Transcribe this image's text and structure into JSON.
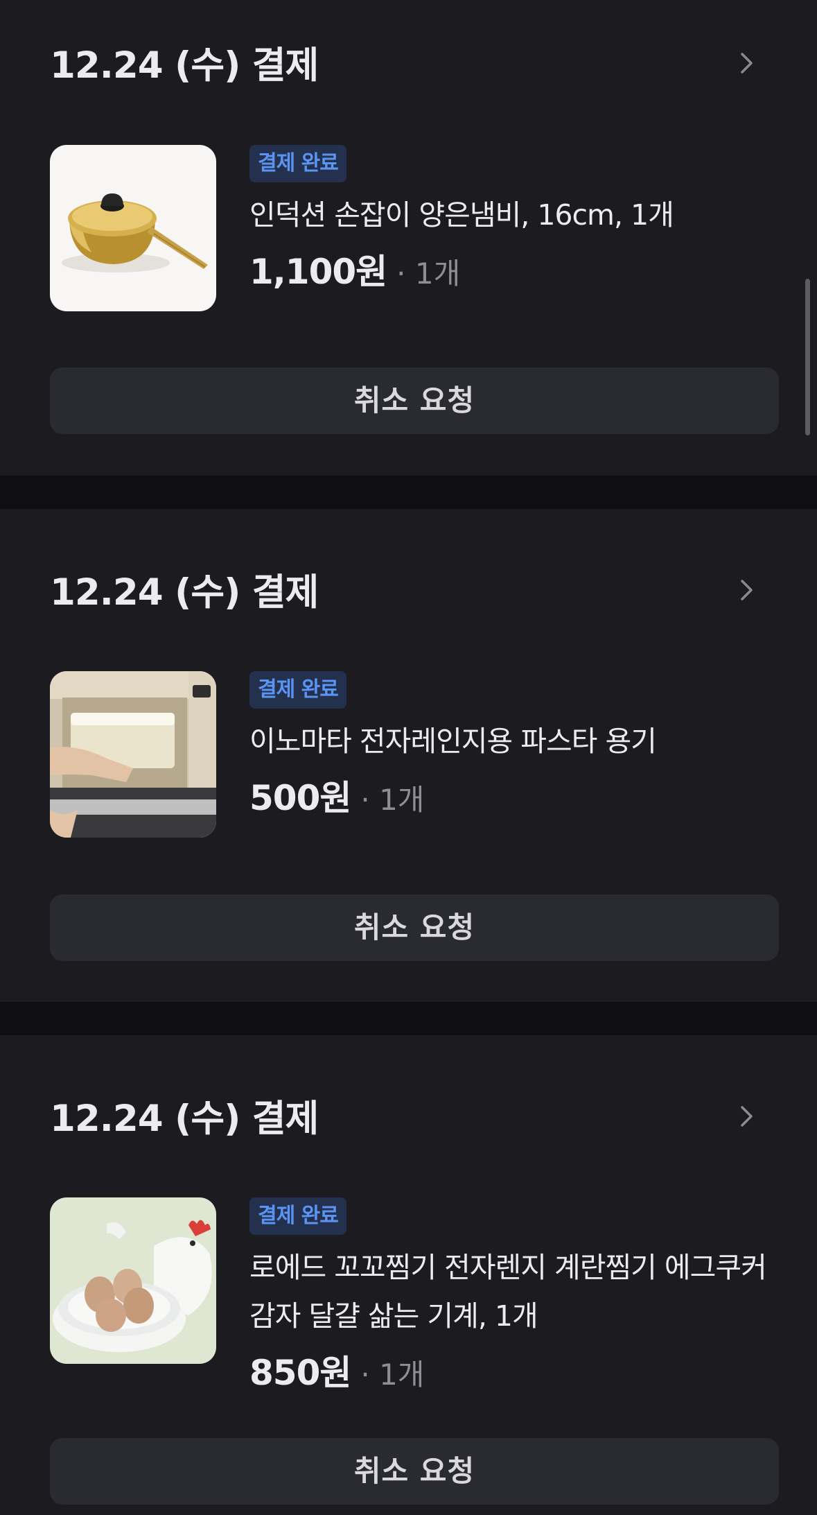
{
  "orders": [
    {
      "date_label": "12.24 (수) 결제",
      "status_badge": "결제 완료",
      "product_name": "인덕션 손잡이 양은냄비, 16cm, 1개",
      "price": "1,100원",
      "quantity": "· 1개",
      "thumbnail": "gold-saucepan-image",
      "cancel_label": "취소 요청"
    },
    {
      "date_label": "12.24 (수) 결제",
      "status_badge": "결제 완료",
      "product_name": "이노마타 전자레인지용 파스타 용기",
      "price": "500원",
      "quantity": "· 1개",
      "thumbnail": "microwave-pasta-container-image",
      "cancel_label": "취소 요청"
    },
    {
      "date_label": "12.24 (수) 결제",
      "status_badge": "결제 완료",
      "product_name": "로에드 꼬꼬찜기 전자렌지 계란찜기 에그쿠커 감자 달걀 삶는 기계, 1개",
      "price": "850원",
      "quantity": "· 1개",
      "thumbnail": "egg-cooker-image",
      "cancel_label": "취소 요청"
    }
  ],
  "colors": {
    "background": "#1b1b20",
    "separator": "#0f0f12",
    "badge_bg": "#23314f",
    "badge_text": "#5b94f2",
    "button_bg": "#2a2b31"
  }
}
